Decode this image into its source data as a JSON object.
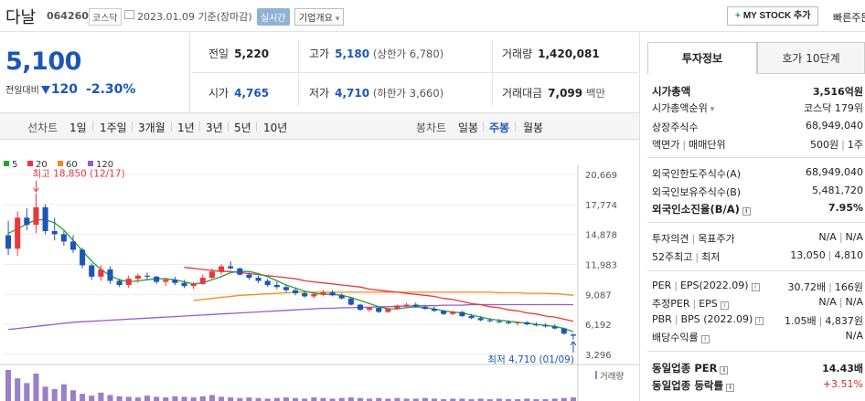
{
  "header": {
    "stock_name": "다날",
    "stock_code": "064260",
    "market": "코스닥",
    "date_text": "2023.01.09 기준(장마감)",
    "realtime_label": "실시간",
    "company_overview_label": "기업개요",
    "mystock_plus": "+",
    "mystock_label": "MY STOCK 추가",
    "quick_order_label": "빠른주문"
  },
  "price": {
    "current": "5,100",
    "change_label": "전일대비",
    "change_value": "120",
    "change_pct": "-2.30%",
    "direction": "down"
  },
  "quote": {
    "prev_close_label": "전일",
    "prev_close": "5,220",
    "high_label": "고가",
    "high": "5,180",
    "upper_limit": "(상한가 6,780)",
    "volume_label": "거래량",
    "volume": "1,420,081",
    "open_label": "시가",
    "open": "4,765",
    "low_label": "저가",
    "low": "4,710",
    "lower_limit": "(하한가 3,660)",
    "amount_label": "거래대금",
    "amount": "7,099",
    "amount_unit": "백만"
  },
  "periods": {
    "line_label": "선차트",
    "line_items": [
      "1일",
      "1주일",
      "3개월",
      "1년",
      "3년",
      "5년",
      "10년"
    ],
    "candle_label": "봉차트",
    "candle_items": [
      "일봉",
      "주봉",
      "월봉"
    ],
    "active": "주봉"
  },
  "chart_data": {
    "type": "line",
    "title": "",
    "legend": [
      {
        "name": "5",
        "color": "#2ca02c"
      },
      {
        "name": "20",
        "color": "#e8383d"
      },
      {
        "name": "60",
        "color": "#f28b20"
      },
      {
        "name": "120",
        "color": "#9b59d0"
      }
    ],
    "y_ticks": [
      "20,669",
      "17,774",
      "14,878",
      "11,983",
      "9,087",
      "6,192",
      "3,296"
    ],
    "ylim": [
      3296,
      20669
    ],
    "high_annotation": "최고 18,850 (12/17)",
    "low_annotation": "최저 4,710 (01/09)",
    "volume_label": "거래량",
    "up_color": "#e8383d",
    "down_color": "#1e55b8",
    "candles": [
      [
        14800,
        16200,
        12900,
        13500
      ],
      [
        13500,
        17100,
        12800,
        16500
      ],
      [
        16500,
        17400,
        15300,
        15800
      ],
      [
        15800,
        18850,
        15000,
        17500
      ],
      [
        17500,
        17800,
        14900,
        15200
      ],
      [
        15200,
        16500,
        14300,
        14900
      ],
      [
        14900,
        15200,
        13800,
        14200
      ],
      [
        14200,
        14800,
        13100,
        13400
      ],
      [
        13400,
        13600,
        11600,
        11900
      ],
      [
        11900,
        12100,
        10500,
        10800
      ],
      [
        10800,
        11900,
        10400,
        11500
      ],
      [
        11500,
        11800,
        10100,
        10400
      ],
      [
        10400,
        10600,
        9800,
        10000
      ],
      [
        10000,
        10900,
        9700,
        10600
      ],
      [
        10600,
        11100,
        10200,
        10900
      ],
      [
        10900,
        11200,
        10500,
        10800
      ],
      [
        10800,
        10900,
        10100,
        10300
      ],
      [
        10300,
        10700,
        9900,
        10500
      ],
      [
        10500,
        10800,
        10000,
        10200
      ],
      [
        10200,
        10500,
        9700,
        9900
      ],
      [
        9900,
        10300,
        9600,
        10100
      ],
      [
        10100,
        11000,
        10000,
        10700
      ],
      [
        10700,
        11600,
        10600,
        11300
      ],
      [
        11300,
        12000,
        11000,
        11800
      ],
      [
        11800,
        12300,
        11500,
        11600
      ],
      [
        11600,
        11700,
        10900,
        11000
      ],
      [
        11000,
        11200,
        10500,
        10700
      ],
      [
        10700,
        10900,
        10200,
        10400
      ],
      [
        10400,
        10600,
        9800,
        10000
      ],
      [
        10000,
        10300,
        9600,
        9800
      ],
      [
        9800,
        10000,
        9300,
        9500
      ],
      [
        9500,
        9700,
        9000,
        9200
      ],
      [
        9200,
        9400,
        8800,
        8900
      ],
      [
        8900,
        9300,
        8700,
        9100
      ],
      [
        9100,
        9500,
        8900,
        9300
      ],
      [
        9300,
        9500,
        8900,
        9000
      ],
      [
        9000,
        9200,
        8600,
        8700
      ],
      [
        8700,
        8800,
        8000,
        8100
      ],
      [
        8100,
        8200,
        7500,
        7600
      ],
      [
        7600,
        7900,
        7400,
        7800
      ],
      [
        7800,
        7900,
        7300,
        7400
      ],
      [
        7400,
        7800,
        7300,
        7700
      ],
      [
        7700,
        8100,
        7600,
        8000
      ],
      [
        8000,
        8300,
        7800,
        8100
      ],
      [
        8100,
        8300,
        7800,
        7900
      ],
      [
        7900,
        8000,
        7600,
        7700
      ],
      [
        7700,
        7900,
        7400,
        7500
      ],
      [
        7500,
        7600,
        7100,
        7200
      ],
      [
        7200,
        7500,
        7100,
        7400
      ],
      [
        7400,
        7500,
        6900,
        7000
      ],
      [
        7000,
        7200,
        6700,
        6800
      ],
      [
        6800,
        7000,
        6500,
        6600
      ],
      [
        6600,
        6800,
        6400,
        6500
      ],
      [
        6500,
        6700,
        6300,
        6400
      ],
      [
        6400,
        6600,
        6200,
        6300
      ],
      [
        6300,
        6500,
        6100,
        6400
      ],
      [
        6400,
        6500,
        6100,
        6200
      ],
      [
        6200,
        6400,
        6000,
        6100
      ],
      [
        6100,
        6300,
        5900,
        6000
      ],
      [
        6000,
        6200,
        5700,
        5800
      ],
      [
        5800,
        5900,
        5200,
        5300
      ],
      [
        5220,
        5300,
        4710,
        5100
      ]
    ],
    "ma5": [
      15000,
      15400,
      15900,
      16300,
      16300,
      16000,
      15300,
      14300,
      13300,
      12300,
      11500,
      10900,
      10500,
      10300,
      10400,
      10500,
      10600,
      10600,
      10500,
      10300,
      10100,
      10200,
      10500,
      10800,
      11200,
      11300,
      11300,
      11100,
      10800,
      10400,
      10000,
      9700,
      9400,
      9200,
      9100,
      9100,
      9000,
      8800,
      8500,
      8200,
      7900,
      7700,
      7700,
      7800,
      7900,
      7800,
      7700,
      7500,
      7400,
      7300,
      7100,
      6900,
      6700,
      6600,
      6500,
      6400,
      6300,
      6200,
      6100,
      6000,
      5800,
      5500
    ],
    "ma20": [
      null,
      null,
      null,
      null,
      null,
      null,
      null,
      null,
      null,
      null,
      null,
      null,
      null,
      null,
      null,
      null,
      null,
      null,
      null,
      11700,
      11600,
      11500,
      11400,
      11300,
      11300,
      11200,
      11100,
      11000,
      10900,
      10800,
      10700,
      10600,
      10400,
      10300,
      10200,
      10100,
      10000,
      9900,
      9800,
      9600,
      9500,
      9400,
      9300,
      9200,
      9100,
      9000,
      8900,
      8700,
      8600,
      8400,
      8200,
      8100,
      7900,
      7800,
      7600,
      7500,
      7300,
      7200,
      7000,
      6900,
      6700,
      6500
    ],
    "ma60": [
      null,
      null,
      null,
      null,
      null,
      null,
      null,
      null,
      null,
      null,
      null,
      null,
      null,
      null,
      null,
      null,
      null,
      null,
      null,
      null,
      8500,
      8600,
      8700,
      8800,
      8900,
      9000,
      9050,
      9100,
      9150,
      9200,
      9250,
      9300,
      9300,
      9300,
      9300,
      9300,
      9300,
      9300,
      9300,
      9300,
      9300,
      9300,
      9300,
      9300,
      9300,
      9300,
      9300,
      9300,
      9300,
      9300,
      9300,
      9300,
      9300,
      9250,
      9250,
      9250,
      9200,
      9200,
      9200,
      9150,
      9100,
      9000
    ],
    "ma120": [
      5700,
      5800,
      5900,
      6000,
      6100,
      6200,
      6300,
      6400,
      6450,
      6500,
      6550,
      6600,
      6650,
      6700,
      6750,
      6800,
      6850,
      6900,
      6950,
      7000,
      7050,
      7100,
      7150,
      7200,
      7250,
      7300,
      7350,
      7400,
      7450,
      7500,
      7550,
      7600,
      7650,
      7700,
      7750,
      7750,
      7800,
      7800,
      7850,
      7850,
      7900,
      7900,
      7950,
      7950,
      8000,
      8000,
      8000,
      8050,
      8050,
      8050,
      8100,
      8100,
      8100,
      8100,
      8100,
      8100,
      8100,
      8100,
      8100,
      8100,
      8100,
      8100
    ],
    "volume": [
      52,
      38,
      30,
      46,
      24,
      20,
      28,
      18,
      12,
      9,
      14,
      10,
      8,
      7,
      6,
      9,
      7,
      6,
      8,
      7,
      6,
      8,
      10,
      7,
      6,
      5,
      6,
      5,
      4,
      5,
      6,
      5,
      4,
      6,
      5,
      4,
      5,
      6,
      5,
      4,
      5,
      4,
      5,
      4,
      4,
      5,
      4,
      3,
      4,
      4,
      3,
      4,
      3,
      4,
      3,
      3,
      4,
      3,
      3,
      4,
      5,
      6
    ]
  },
  "panel": {
    "tab_info": "투자정보",
    "tab_orderbook": "호가 10단계",
    "market_cap_label": "시가총액",
    "market_cap": "3,516억원",
    "cap_rank_label": "시가총액순위",
    "cap_rank": "코스닥 179위",
    "shares_label": "상장주식수",
    "shares": "68,949,040",
    "par_label": "액면가",
    "trade_unit_label": "매매단위",
    "par": "500원",
    "trade_unit": "1주",
    "foreign_limit_label": "외국인한도주식수(A)",
    "foreign_limit": "68,949,040",
    "foreign_hold_label": "외국인보유주식수(B)",
    "foreign_hold": "5,481,720",
    "foreign_ratio_label": "외국인소진율(B/A)",
    "foreign_ratio": "7.95%",
    "opinion_label": "투자의견",
    "target_label": "목표주가",
    "opinion": "N/A",
    "target": "N/A",
    "w52_high_label": "52주최고",
    "w52_low_label": "최저",
    "w52_high": "13,050",
    "w52_low": "4,810",
    "per_label": "PER",
    "eps_label": "EPS(2022.09)",
    "per": "30.72배",
    "eps": "166원",
    "est_per_label": "추정PER",
    "est_eps_label": "EPS",
    "est_per": "N/A",
    "est_eps": "N/A",
    "pbr_label": "PBR",
    "bps_label": "BPS (2022.09)",
    "pbr": "1.05배",
    "bps": "4,837원",
    "div_label": "배당수익률",
    "div": "N/A",
    "ind_per_label": "동일업종 PER",
    "ind_per": "14.43배",
    "ind_chg_label": "동일업종 등락률",
    "ind_chg": "+3.51%",
    "sep": "|",
    "info_mark": "i"
  }
}
